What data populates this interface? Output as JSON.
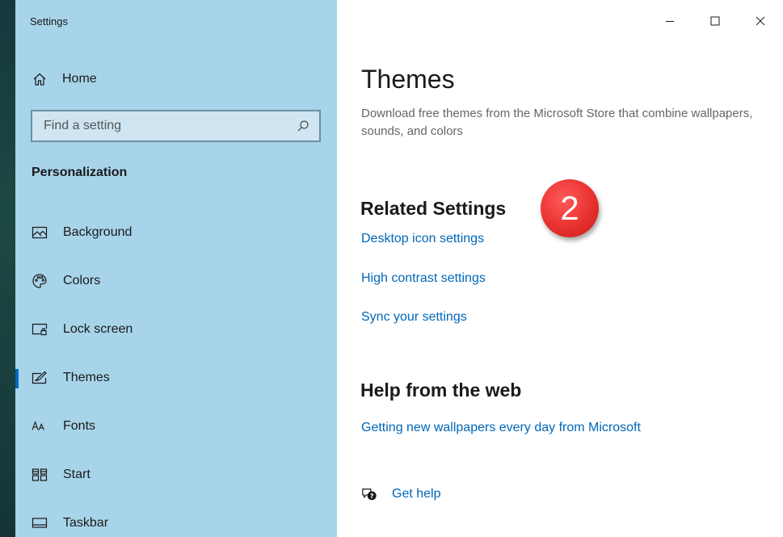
{
  "window": {
    "title": "Settings",
    "controls": [
      "minimize-icon",
      "maximize-icon",
      "close-icon"
    ]
  },
  "sidebar": {
    "home_label": "Home",
    "search_placeholder": "Find a setting",
    "section_title": "Personalization",
    "items": [
      {
        "label": "Background",
        "icon": "background-icon",
        "active": false
      },
      {
        "label": "Colors",
        "icon": "palette-icon",
        "active": false
      },
      {
        "label": "Lock screen",
        "icon": "lock-screen-icon",
        "active": false
      },
      {
        "label": "Themes",
        "icon": "themes-icon",
        "active": true
      },
      {
        "label": "Fonts",
        "icon": "fonts-icon",
        "active": false
      },
      {
        "label": "Start",
        "icon": "start-icon",
        "active": false
      },
      {
        "label": "Taskbar",
        "icon": "taskbar-icon",
        "active": false
      }
    ]
  },
  "main": {
    "title": "Themes",
    "description": "Download free themes from the Microsoft Store that combine wallpapers, sounds, and colors",
    "related_heading": "Related Settings",
    "related_links": [
      "Desktop icon settings",
      "High contrast settings",
      "Sync your settings"
    ],
    "help_heading": "Help from the web",
    "help_links": [
      "Getting new wallpapers every day from Microsoft"
    ],
    "get_help_label": "Get help"
  },
  "annotation": {
    "step_number": "2"
  },
  "colors": {
    "sidebar_bg": "#a8d4ea",
    "link": "#0067b8",
    "accent": "#0067c0",
    "badge": "#e8322f"
  }
}
